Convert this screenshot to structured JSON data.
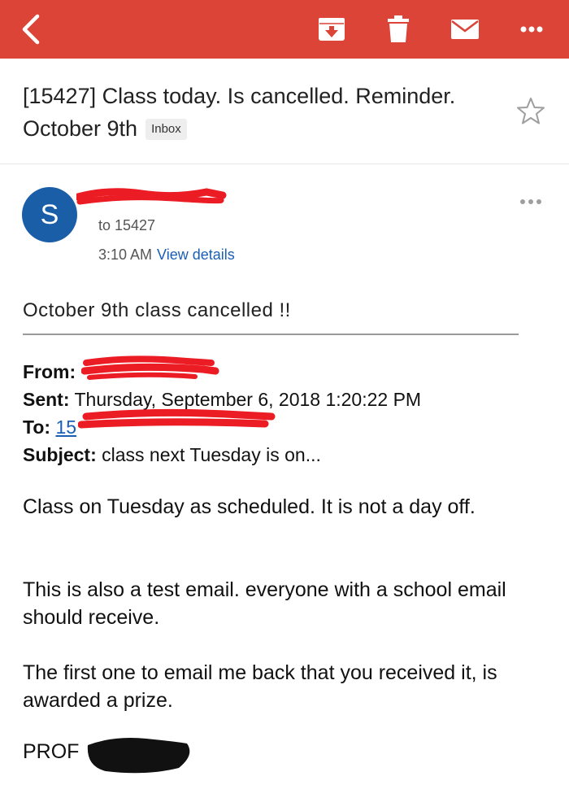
{
  "toolbar": {
    "icons": [
      "back-arrow-icon",
      "archive-icon",
      "trash-icon",
      "mail-icon",
      "more-vertical-icon"
    ],
    "color": "#db4437"
  },
  "thread": {
    "subject": "[15427] Class today. Is cancelled.   Reminder. October 9th",
    "label": "Inbox"
  },
  "message_header": {
    "avatar_letter": "S",
    "avatar_color": "#1a5ea8",
    "to": "to 15427",
    "time": "3:10 AM",
    "view_details": "View details"
  },
  "message": {
    "subject": "October 9th class cancelled !!",
    "fields": {
      "from_label": "From:",
      "sent_label": "Sent:",
      "sent_value": "Thursday, September 6, 2018 1:20:22 PM",
      "to_label": "To:",
      "to_value_visible": "15",
      "subject_label": "Subject:",
      "subject_value": "class next Tuesday is on..."
    },
    "paragraphs": [
      "Class on Tuesday as scheduled.  It is not a day off.",
      "This is also a test email. everyone with a school email should receive.",
      "The first one to email me back that you received it, is awarded a prize."
    ],
    "signature": "PROF"
  },
  "redaction_colors": {
    "red": "#ec1c24",
    "black": "#111111"
  }
}
